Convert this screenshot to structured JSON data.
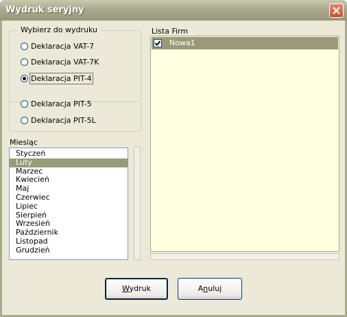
{
  "window": {
    "title": "Wydruk seryjny"
  },
  "group": {
    "legend": "Wybierz do wydruku",
    "options": [
      {
        "label": "Deklaracja VAT-7",
        "checked": false
      },
      {
        "label": "Deklaracja VAT-7K",
        "checked": false
      },
      {
        "label": "Deklaracja PIT-4",
        "checked": true
      },
      {
        "label": "Deklaracja PIT-5",
        "checked": false
      },
      {
        "label": "Deklaracja PIT-5L",
        "checked": false
      }
    ]
  },
  "month": {
    "label": "Miesiąc",
    "items": [
      "Styczeń",
      "Luty",
      "Marzec",
      "Kwiecień",
      "Maj",
      "Czerwiec",
      "Lipiec",
      "Sierpień",
      "Wrzesień",
      "Październik",
      "Listopad",
      "Grudzień"
    ],
    "selected": "Luty"
  },
  "firms": {
    "label": "Lista Firm",
    "items": [
      {
        "name": "Nowa1",
        "checked": true
      }
    ]
  },
  "buttons": {
    "print": {
      "hot": "W",
      "rest": "ydruk"
    },
    "cancel": {
      "pre": "A",
      "hot": "n",
      "rest": "uluj"
    }
  },
  "colors": {
    "selection": "#9a9a78",
    "firm_list_bg": "#ffffe1",
    "dialog_bg": "#ece9d8"
  }
}
